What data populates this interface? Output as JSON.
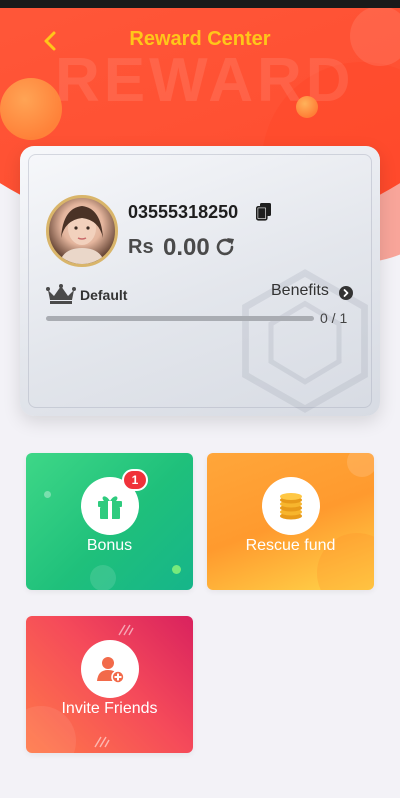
{
  "header": {
    "title": "Reward Center",
    "watermark": "REWARD",
    "back_icon": "chevron-left-icon",
    "title_color": "#ffc61a",
    "bg_color": "#ff5a3c"
  },
  "user": {
    "phone": "03555318250",
    "currency": "Rs",
    "balance": "0.00",
    "level": "Default",
    "benefits_label": "Benefits",
    "progress_text": "0 / 1",
    "progress_fraction": 0,
    "icons": [
      "copy-icon",
      "refresh-icon",
      "crown-icon",
      "chevron-right-circle-icon"
    ]
  },
  "tiles": [
    {
      "label": "Bonus",
      "icon": "gift-icon",
      "badge": "1",
      "color": "#1fc07b"
    },
    {
      "label": "Rescue fund",
      "icon": "coins-icon",
      "color": "#ffa63a"
    },
    {
      "label": "Invite Friends",
      "icon": "add-user-icon",
      "color": "#f54a5a"
    }
  ]
}
